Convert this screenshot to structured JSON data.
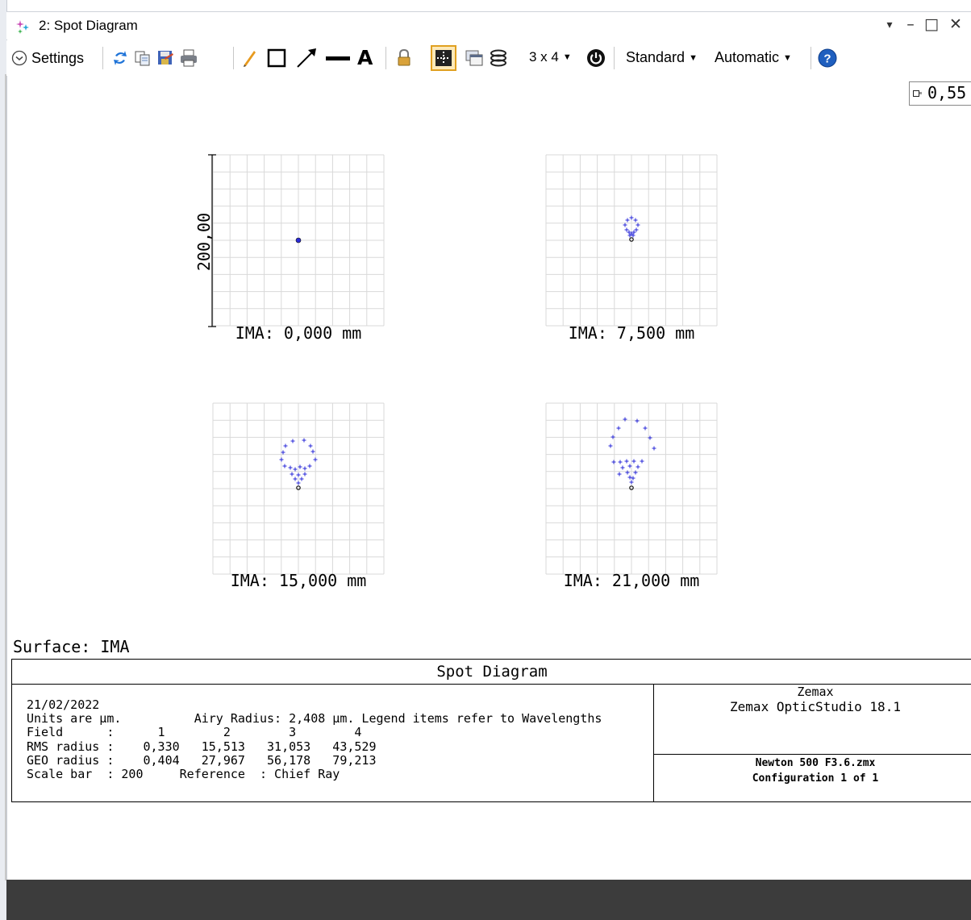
{
  "window": {
    "title": "2: Spot Diagram",
    "controls": {
      "dropdown": "▾",
      "minimize": "–",
      "maximize": "□",
      "close": "✕"
    }
  },
  "toolbar": {
    "settings_label": "Settings",
    "layout_label": "3 x 4",
    "standard_label": "Standard",
    "automatic_label": "Automatic",
    "icons": [
      "refresh-icon",
      "copy-icon",
      "save-icon",
      "print-icon",
      "pencil-icon",
      "rectangle-icon",
      "arrow-icon",
      "line-icon",
      "text-icon",
      "lock-icon",
      "grid-icon",
      "window-icon",
      "layers-icon",
      "power-icon",
      "help-icon"
    ]
  },
  "legend": {
    "value": "0,55"
  },
  "scale_bar": {
    "label": "200,00"
  },
  "plots": [
    {
      "label": "IMA: 0,000 mm"
    },
    {
      "label": "IMA: 7,500 mm"
    },
    {
      "label": "IMA: 15,000 mm"
    },
    {
      "label": "IMA: 21,000 mm"
    }
  ],
  "surface": {
    "label": "Surface: IMA"
  },
  "info": {
    "title": "Spot Diagram",
    "date": "21/02/2022",
    "units_line": "Units are µm.          Airy Radius: 2,408 µm. Legend items refer to Wavelengths",
    "field_line": "Field      :      1        2        3        4",
    "rms_line": "RMS radius :    0,330   15,513   31,053   43,529",
    "geo_line": "GEO radius :    0,404   27,967   56,178   79,213",
    "scale_line": "Scale bar  : 200     Reference  : Chief Ray",
    "company": "Zemax",
    "product": "Zemax OpticStudio 18.1",
    "file": "Newton 500 F3.6.zmx",
    "configuration": "Configuration 1 of 1"
  },
  "colors": {
    "spot": "#2a2ad8",
    "grid": "#d9d9d9",
    "bottom_bar": "#3c3c3c"
  }
}
